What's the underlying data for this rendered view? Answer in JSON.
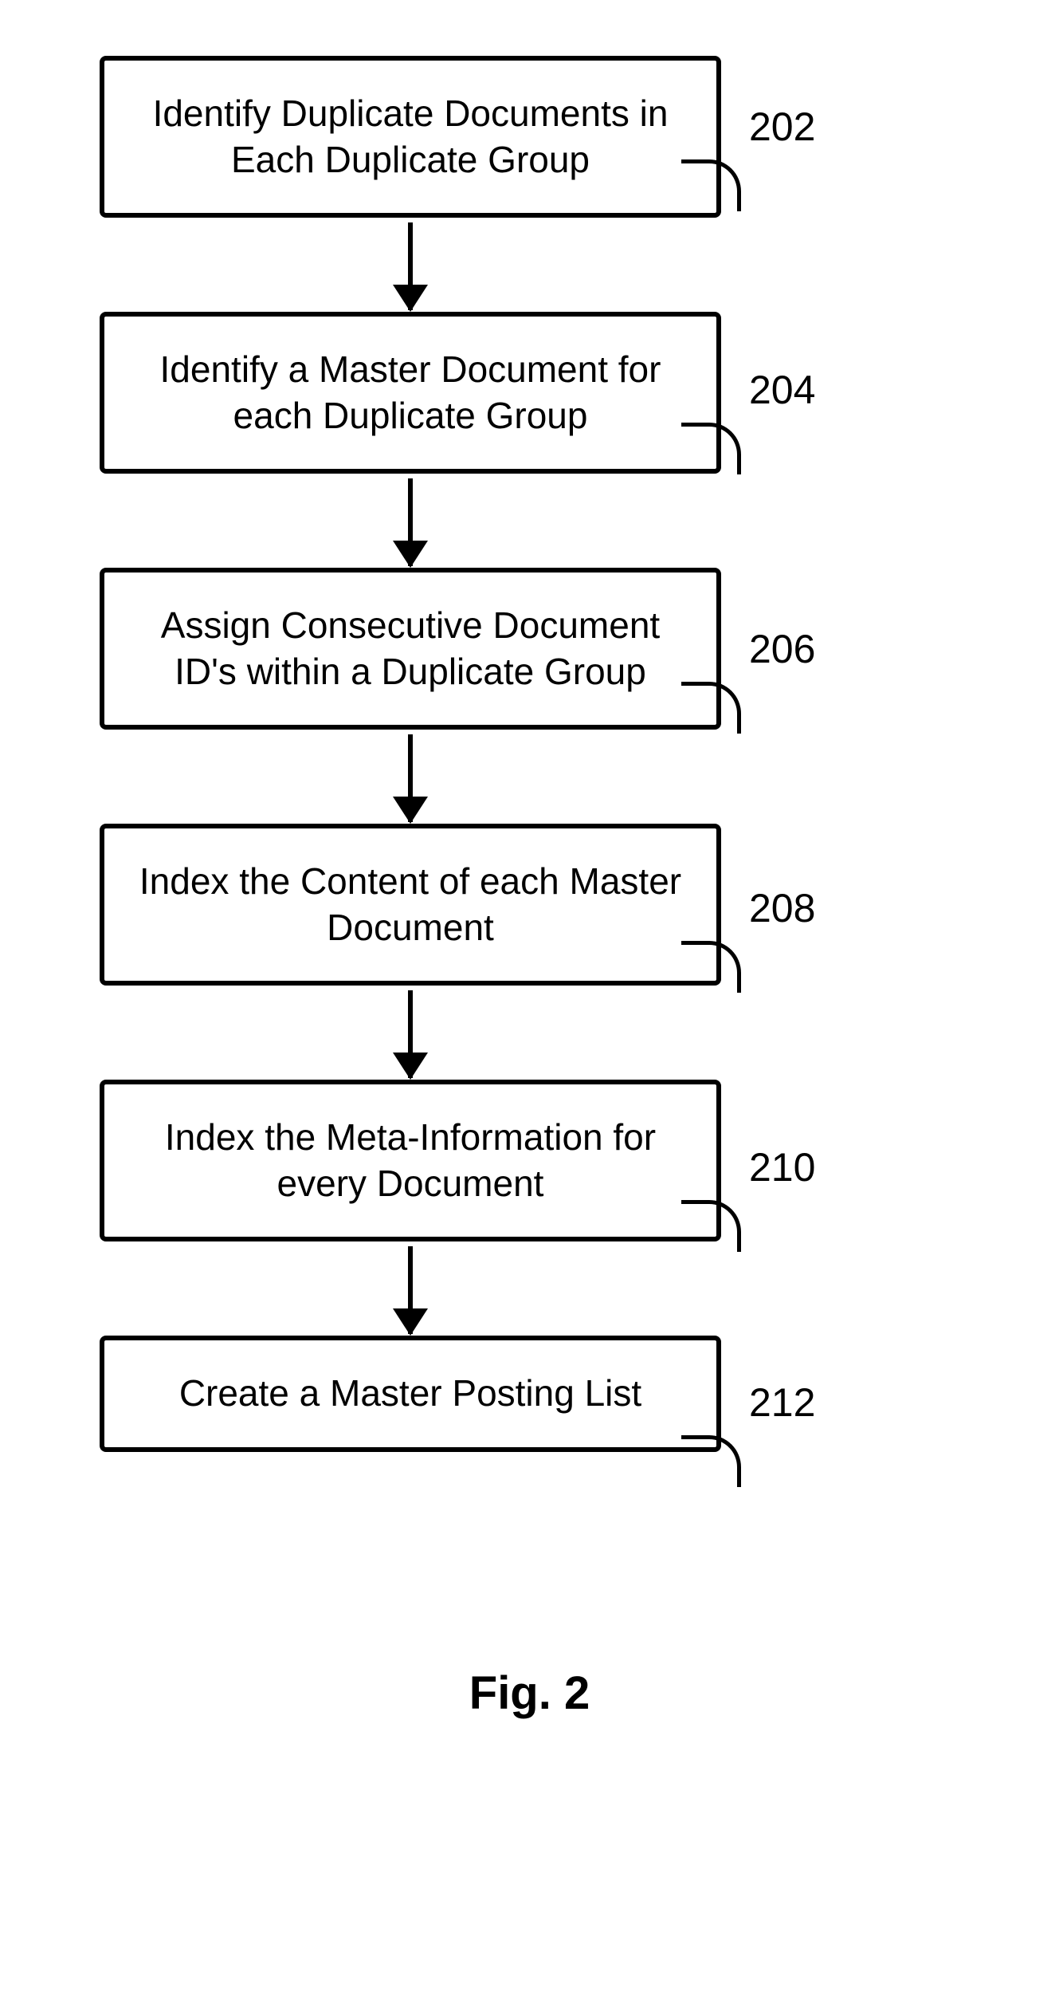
{
  "chart_data": {
    "type": "flowchart",
    "title": "Fig. 2",
    "nodes": [
      {
        "id": "202",
        "label": "Identify Duplicate Documents in Each Duplicate Group"
      },
      {
        "id": "204",
        "label": "Identify a Master Document for each Duplicate Group"
      },
      {
        "id": "206",
        "label": "Assign Consecutive Document ID's within a Duplicate Group"
      },
      {
        "id": "208",
        "label": "Index the Content of each Master Document"
      },
      {
        "id": "210",
        "label": "Index the Meta-Information for every Document"
      },
      {
        "id": "212",
        "label": "Create a Master Posting List"
      }
    ],
    "edges": [
      {
        "from": "202",
        "to": "204"
      },
      {
        "from": "204",
        "to": "206"
      },
      {
        "from": "206",
        "to": "208"
      },
      {
        "from": "208",
        "to": "210"
      },
      {
        "from": "210",
        "to": "212"
      }
    ]
  },
  "steps": {
    "s202": {
      "text": "Identify Duplicate Documents in Each Duplicate Group",
      "ref": "202"
    },
    "s204": {
      "text": "Identify a Master Document for each Duplicate Group",
      "ref": "204"
    },
    "s206": {
      "text": "Assign Consecutive Document ID's within a Duplicate Group",
      "ref": "206"
    },
    "s208": {
      "text": "Index the Content of each Master Document",
      "ref": "208"
    },
    "s210": {
      "text": "Index the Meta-Information for every Document",
      "ref": "210"
    },
    "s212": {
      "text": "Create a Master Posting List",
      "ref": "212"
    }
  },
  "caption": "Fig. 2"
}
